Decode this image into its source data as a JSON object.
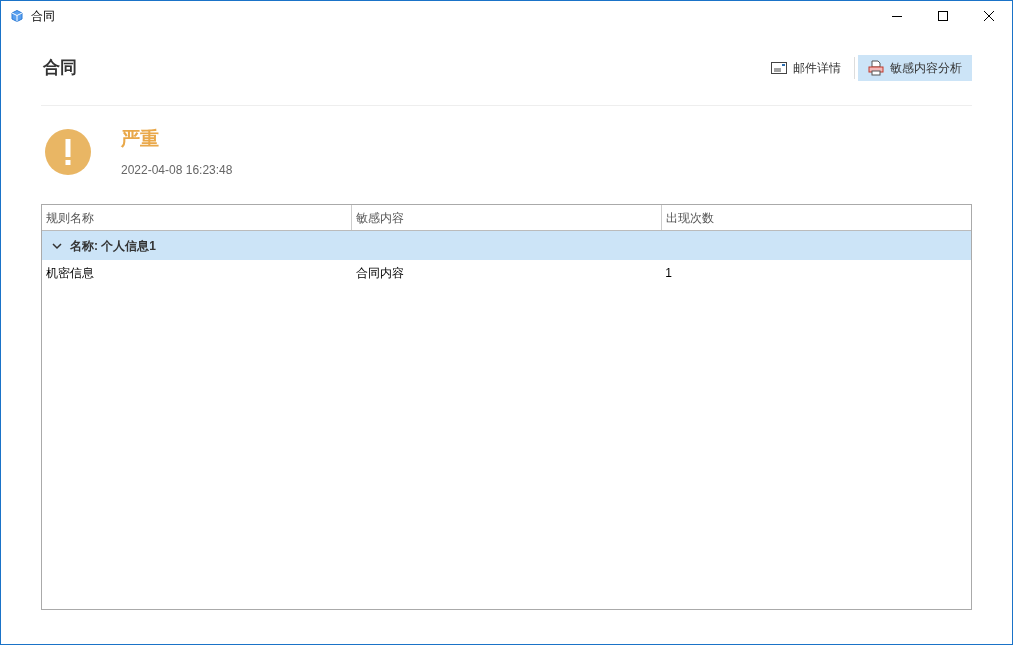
{
  "window": {
    "title": "合同"
  },
  "header": {
    "title": "合同",
    "actions": [
      {
        "label": "邮件详情",
        "kind": "mail",
        "selected": false
      },
      {
        "label": "敏感内容分析",
        "kind": "print",
        "selected": true
      }
    ]
  },
  "alert": {
    "level_label": "严重",
    "time": "2022-04-08 16:23:48"
  },
  "table": {
    "columns": [
      "规则名称",
      "敏感内容",
      "出现次数"
    ],
    "groups": [
      {
        "label": "名称: 个人信息1",
        "expanded": true,
        "rows": [
          [
            "机密信息",
            "合同内容",
            "1"
          ]
        ]
      }
    ]
  }
}
